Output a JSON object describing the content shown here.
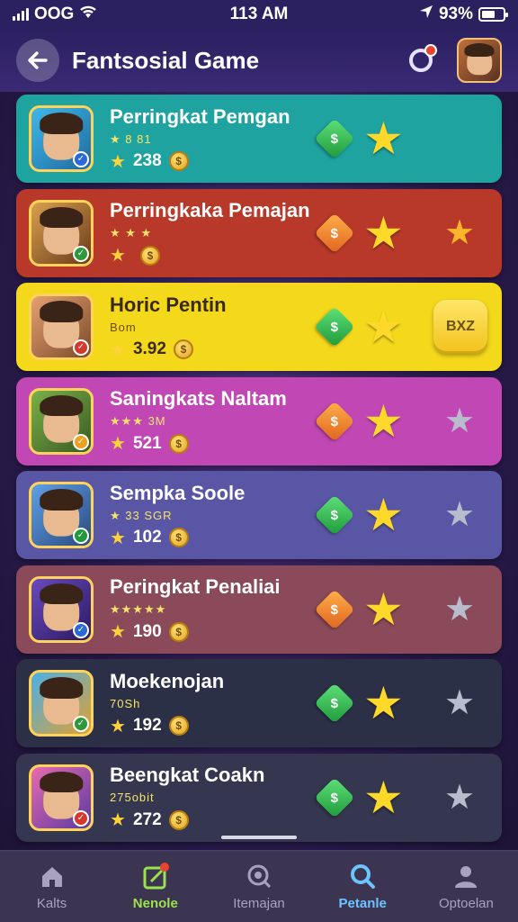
{
  "status_bar": {
    "carrier": "OOG",
    "time": "113 AM",
    "battery": "93%"
  },
  "header": {
    "title": "Fantsosial Game"
  },
  "rows": [
    {
      "name": "Perringkat Pemgan",
      "sub": "★ 8 81",
      "score": "238",
      "gem": "$",
      "gem_color": "green",
      "end": "none",
      "bg": "#1fa3a0",
      "thumb_note": "MIIBO"
    },
    {
      "name": "Perringkaka Pemajan",
      "sub": "★ ★ ★",
      "score": "",
      "gem": "$",
      "gem_color": "orange",
      "end": "gold-star",
      "bg": "#b8392a",
      "thumb_note": ""
    },
    {
      "name": "Horic Pentin",
      "sub": "Bom",
      "score": "3.92",
      "gem": "$",
      "gem_color": "green",
      "end": "button",
      "end_label": "BXZ",
      "bg": "#f4d81c",
      "thumb_note": ""
    },
    {
      "name": "Saningkats Naltam",
      "sub": "★★★ 3M",
      "score": "521",
      "gem": "$",
      "gem_color": "orange",
      "end": "gray-star",
      "bg": "#c148b4",
      "thumb_note": ""
    },
    {
      "name": "Sempka Soole",
      "sub": "★ 33 SGR",
      "score": "102",
      "gem": "$",
      "gem_color": "green",
      "end": "gray-star",
      "bg": "#5a56a6",
      "thumb_note": ""
    },
    {
      "name": "Peringkat Penaliai",
      "sub": "★★★★★",
      "score": "190",
      "gem": "$",
      "gem_color": "orange",
      "end": "gray-star",
      "bg": "#8a4a5a",
      "thumb_note": ""
    },
    {
      "name": "Moekenojan",
      "sub": "70Sh",
      "score": "192",
      "gem": "$",
      "gem_color": "green",
      "end": "gray-star",
      "bg": "#2c3046",
      "thumb_note": ""
    },
    {
      "name": "Beengkat Coakn",
      "sub": "275obit",
      "score": "272",
      "gem": "$",
      "gem_color": "green",
      "end": "gray-star",
      "bg": "#35364f",
      "thumb_note": ""
    }
  ],
  "nav": [
    {
      "label": "Kalts",
      "icon": "home-icon",
      "state": ""
    },
    {
      "label": "Nenole",
      "icon": "edit-icon",
      "state": "active-green"
    },
    {
      "label": "Itemajan",
      "icon": "target-icon",
      "state": ""
    },
    {
      "label": "Petanle",
      "icon": "search-icon",
      "state": "active-blue"
    },
    {
      "label": "Optoelan",
      "icon": "user-icon",
      "state": ""
    }
  ]
}
